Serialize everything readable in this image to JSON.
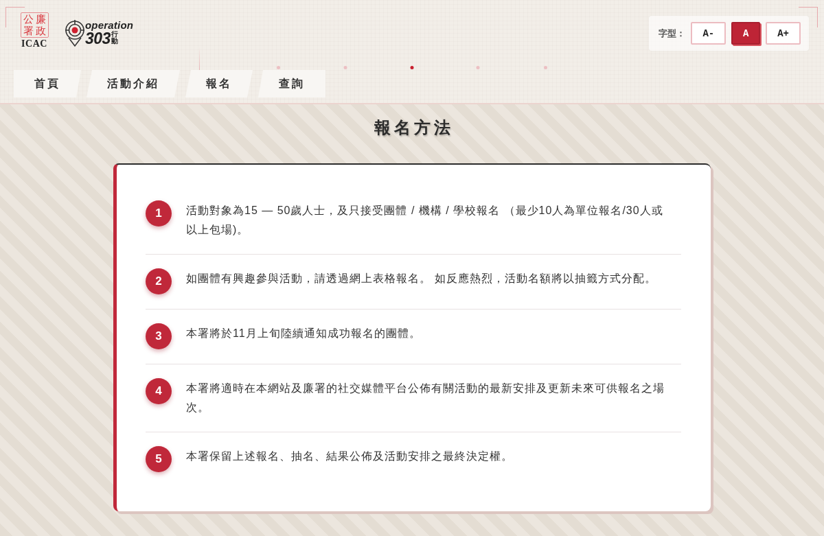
{
  "header": {
    "icac_logo": {
      "seal_columns": [
        "公署",
        "廉政"
      ],
      "caption": "ICAC"
    },
    "operation_logo": {
      "word": "operation",
      "number": "303",
      "chinese": "行動"
    },
    "font_size": {
      "label": "字型：",
      "options": [
        {
          "label": "A-",
          "selected": false
        },
        {
          "label": "A",
          "selected": true
        },
        {
          "label": "A+",
          "selected": false
        }
      ]
    },
    "nav": [
      {
        "label": "首頁"
      },
      {
        "label": "活動介紹"
      },
      {
        "label": "報名"
      },
      {
        "label": "查詢"
      }
    ]
  },
  "page_title": "報名方法",
  "steps": [
    {
      "number": "1",
      "text": "活動對象為15 — 50歲人士，及只接受團體 / 機構 / 學校報名 （最少10人為單位報名/30人或以上包場)。"
    },
    {
      "number": "2",
      "text": "如團體有興趣參與活動，請透過網上表格報名。 如反應熱烈，活動名額將以抽籤方式分配。"
    },
    {
      "number": "3",
      "text": "本署將於11月上旬陸續通知成功報名的團體。"
    },
    {
      "number": "4",
      "text": "本署將適時在本網站及廉署的社交媒體平台公佈有關活動的最新安排及更新未來可供報名之場次。"
    },
    {
      "number": "5",
      "text": "本署保留上述報名、抽名、結果公佈及活動安排之最終決定權。"
    }
  ]
}
